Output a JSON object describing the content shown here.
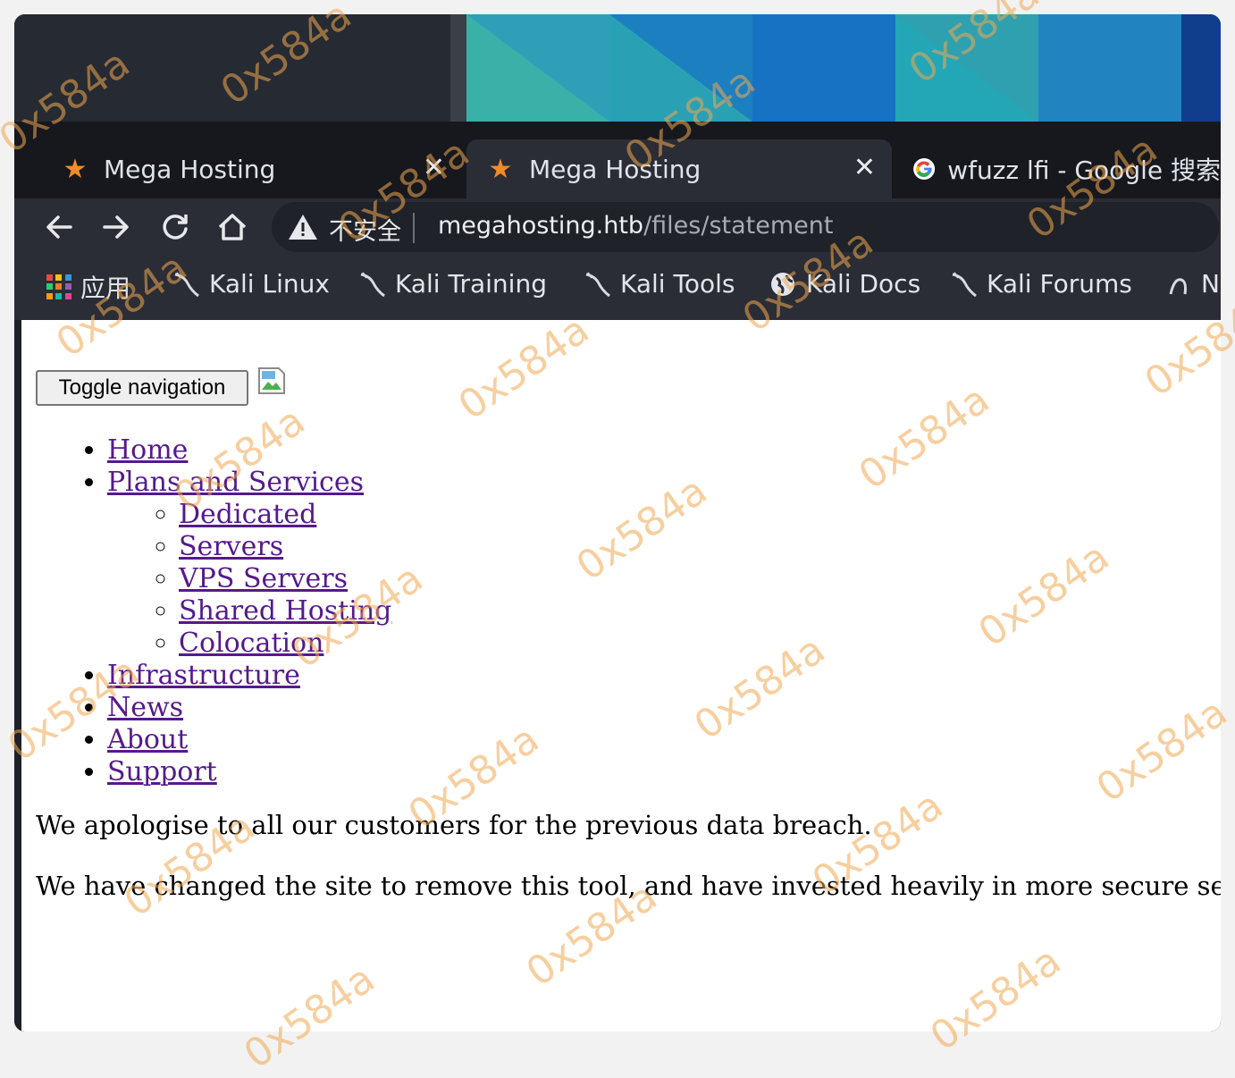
{
  "browser": {
    "tabs": [
      {
        "title": "Mega Hosting",
        "icon": "star-icon",
        "active": false
      },
      {
        "title": "Mega Hosting",
        "icon": "star-icon",
        "active": true
      },
      {
        "title": "wfuzz lfi - Google 搜索",
        "icon": "google-icon",
        "active": false
      }
    ],
    "toolbar": {
      "security_label": "不安全",
      "url_host": "megahosting.htb",
      "url_path": "/files/statement"
    },
    "bookmarks": {
      "apps_label": "应用",
      "items": [
        "Kali Linux",
        "Kali Training",
        "Kali Tools",
        "Kali Docs",
        "Kali Forums",
        "N"
      ]
    }
  },
  "page": {
    "toggle_label": "Toggle navigation",
    "nav": {
      "home": "Home",
      "plans": "Plans and Services",
      "plans_sub": [
        "Dedicated",
        "Servers",
        "VPS Servers",
        "Shared Hosting",
        "Colocation"
      ],
      "infrastructure": "Infrastructure",
      "news": "News",
      "about": "About",
      "support": "Support"
    },
    "paragraphs": [
      "We apologise to all our customers for the previous data breach.",
      "We have changed the site to remove this tool, and have invested heavily in more secure servers"
    ]
  },
  "watermark": "0x584a",
  "colors": {
    "link": "#551a8b",
    "tab_star": "#f08a2b",
    "watermark": "#f0a850"
  }
}
